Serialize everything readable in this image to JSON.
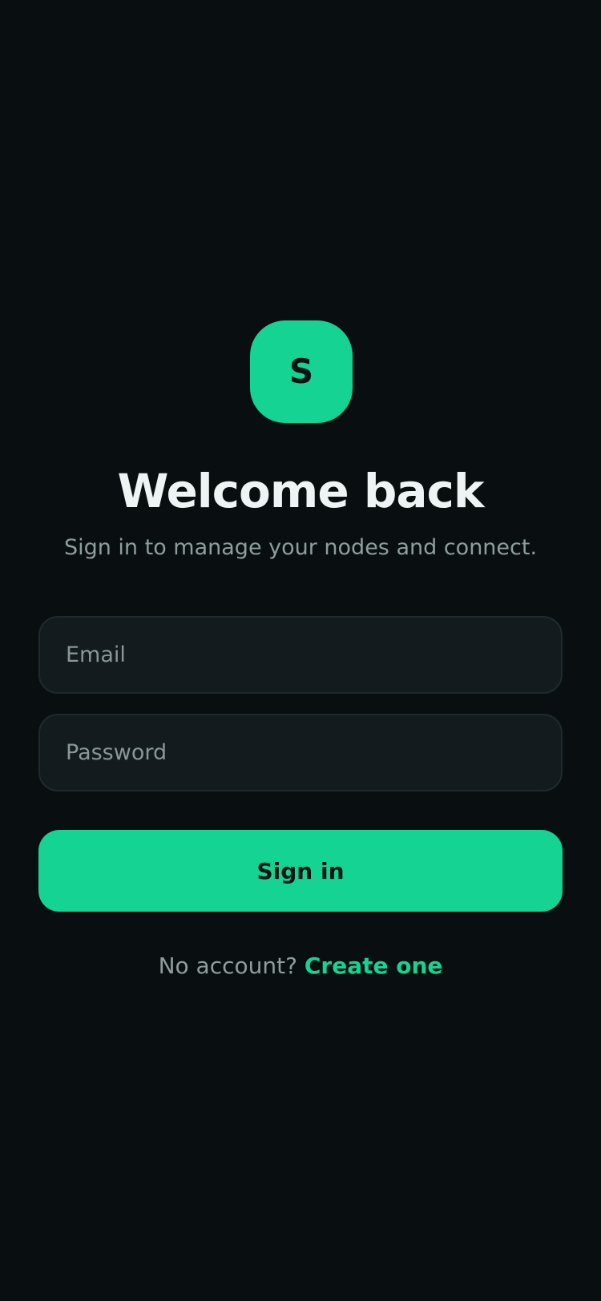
{
  "logo": {
    "letter": "S"
  },
  "header": {
    "title": "Welcome back",
    "subtitle": "Sign in to manage your nodes and connect."
  },
  "form": {
    "email_placeholder": "Email",
    "email_value": "",
    "password_placeholder": "Password",
    "password_value": "",
    "submit_label": "Sign in"
  },
  "footer": {
    "prompt": "No account?",
    "link_label": "Create one"
  },
  "colors": {
    "background": "#090f11",
    "accent": "#14d393",
    "field_background": "#131b1e",
    "field_border": "#1f2a2c",
    "text_primary": "#eef4f3",
    "text_secondary": "#8f9d9c"
  }
}
